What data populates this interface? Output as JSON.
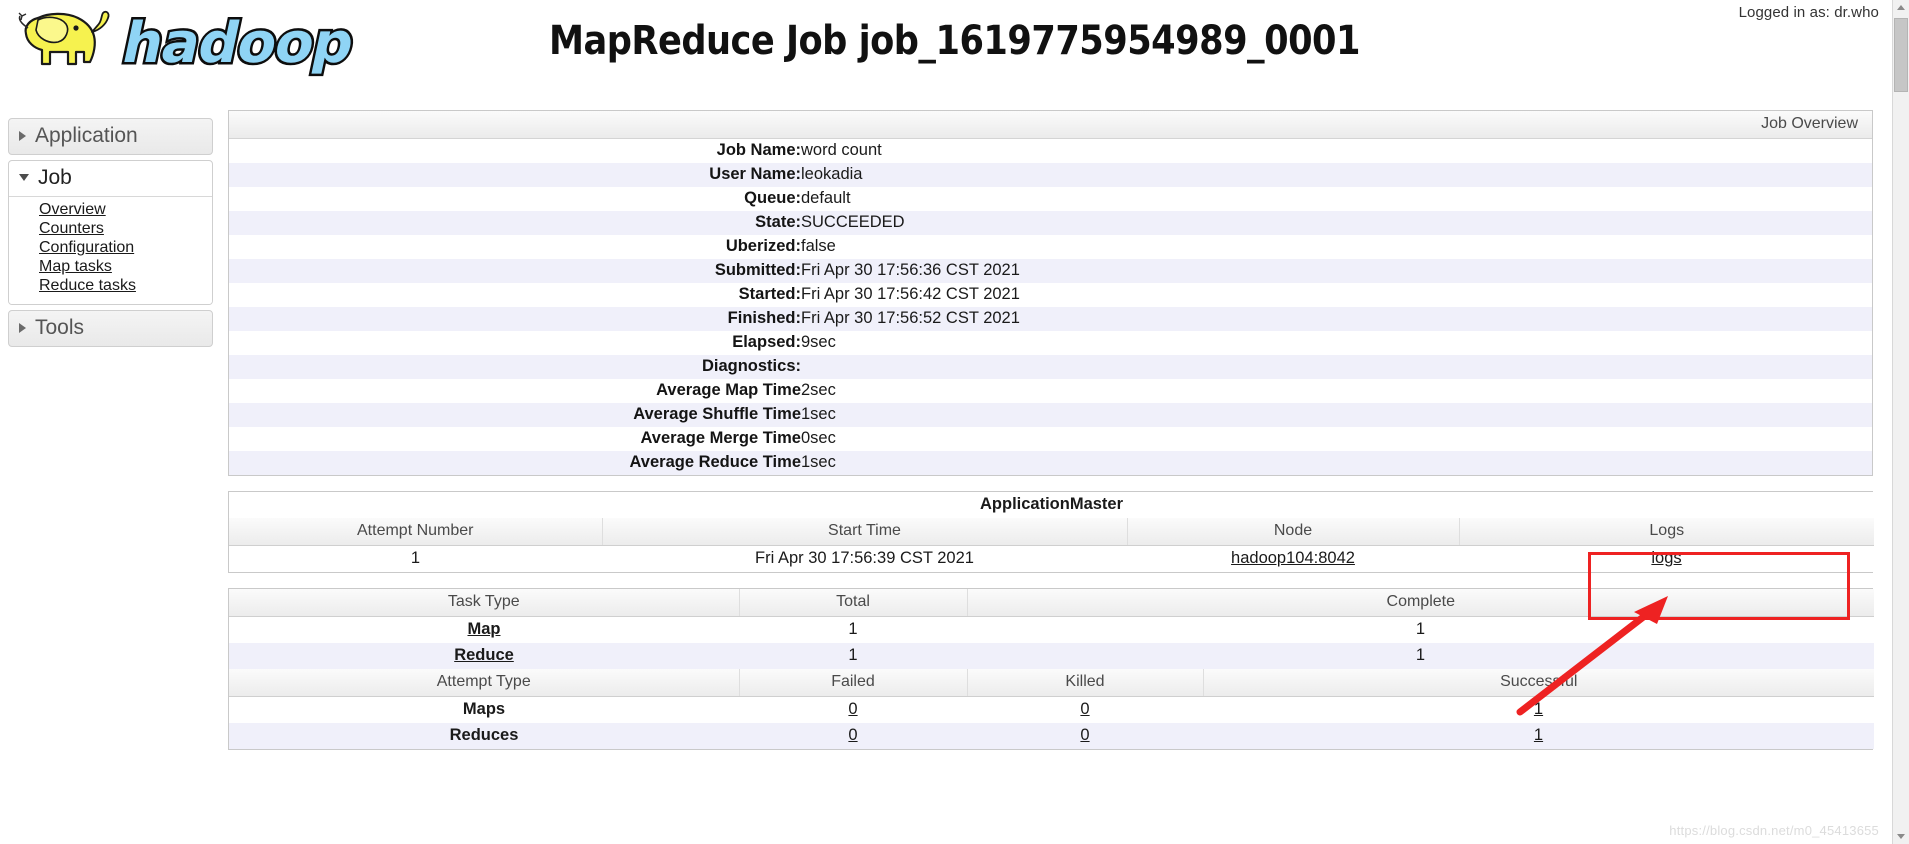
{
  "header": {
    "logged_in_text": "Logged in as: dr.who",
    "page_title": "MapReduce Job job_1619775954989_0001",
    "logo_text": "hadoop"
  },
  "sidebar": {
    "sections": [
      {
        "label": "Application",
        "expanded": false,
        "icon": "chevron-right-icon",
        "items": []
      },
      {
        "label": "Job",
        "expanded": true,
        "icon": "chevron-down-icon",
        "items": [
          "Overview",
          "Counters",
          "Configuration",
          "Map tasks",
          "Reduce tasks"
        ]
      },
      {
        "label": "Tools",
        "expanded": false,
        "icon": "chevron-right-icon",
        "items": []
      }
    ]
  },
  "job_overview": {
    "caption": "Job Overview",
    "rows": [
      {
        "label": "Job Name:",
        "value": "word count"
      },
      {
        "label": "User Name:",
        "value": "leokadia"
      },
      {
        "label": "Queue:",
        "value": "default"
      },
      {
        "label": "State:",
        "value": "SUCCEEDED"
      },
      {
        "label": "Uberized:",
        "value": "false"
      },
      {
        "label": "Submitted:",
        "value": "Fri Apr 30 17:56:36 CST 2021"
      },
      {
        "label": "Started:",
        "value": "Fri Apr 30 17:56:42 CST 2021"
      },
      {
        "label": "Finished:",
        "value": "Fri Apr 30 17:56:52 CST 2021"
      },
      {
        "label": "Elapsed:",
        "value": "9sec"
      },
      {
        "label": "Diagnostics:",
        "value": ""
      },
      {
        "label": "Average Map Time",
        "value": "2sec"
      },
      {
        "label": "Average Shuffle Time",
        "value": "1sec"
      },
      {
        "label": "Average Merge Time",
        "value": "0sec"
      },
      {
        "label": "Average Reduce Time",
        "value": "1sec"
      }
    ]
  },
  "app_master": {
    "title": "ApplicationMaster",
    "columns": [
      "Attempt Number",
      "Start Time",
      "Node",
      "Logs"
    ],
    "row": {
      "attempt_number": "1",
      "start_time": "Fri Apr 30 17:56:39 CST 2021",
      "node": "hadoop104:8042",
      "logs": "logs"
    }
  },
  "task_table": {
    "columns": [
      "Task Type",
      "Total",
      "Complete"
    ],
    "rows": [
      {
        "type": "Map",
        "total": "1",
        "complete": "1"
      },
      {
        "type": "Reduce",
        "total": "1",
        "complete": "1"
      }
    ]
  },
  "attempt_table": {
    "columns": [
      "Attempt Type",
      "Failed",
      "Killed",
      "Successful"
    ],
    "rows": [
      {
        "type": "Maps",
        "failed": "0",
        "killed": "0",
        "successful": "1"
      },
      {
        "type": "Reduces",
        "failed": "0",
        "killed": "0",
        "successful": "1"
      }
    ]
  },
  "annotation": {
    "box_color": "#ee2222",
    "arrow_color": "#ee2222",
    "target": "logs"
  },
  "watermark": "https://blog.csdn.net/m0_45413655"
}
